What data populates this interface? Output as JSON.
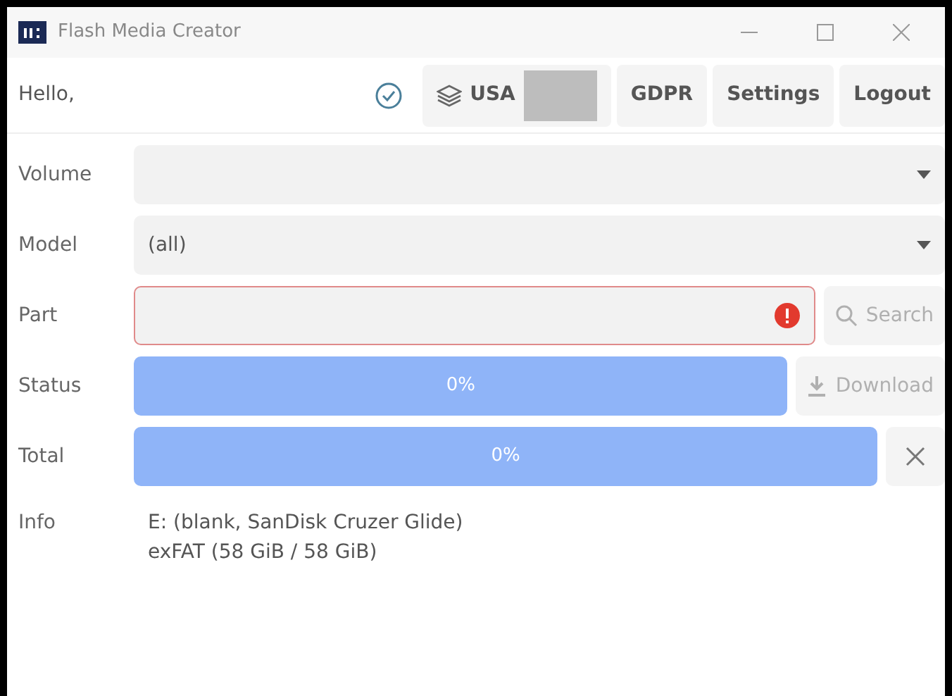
{
  "window": {
    "title": "Flash Media Creator"
  },
  "header": {
    "greeting": "Hello,",
    "account": "USA",
    "buttons": [
      "GDPR",
      "Settings",
      "Logout"
    ]
  },
  "fields": [
    {
      "kind": "select",
      "label": "Volume"
    },
    {
      "kind": "select",
      "label": "Model",
      "value": "(all)"
    },
    {
      "kind": "search",
      "label": "Part",
      "invalid": true,
      "button": {
        "label": "Search",
        "disabled": true
      }
    },
    {
      "kind": "progress",
      "label": "Status",
      "level": 0,
      "reading": "0%",
      "button": {
        "label": "Download",
        "disabled": true
      }
    },
    {
      "kind": "progress",
      "label": "Total",
      "level": 0,
      "reading": "0%",
      "button": {
        "kind": "cancel",
        "disabled": false
      }
    },
    {
      "kind": "info",
      "label": "Info",
      "lines": [
        "E: (blank, SanDisk Cruzer Glide)",
        "exFAT (58 GiB / 58 GiB)"
      ]
    }
  ]
}
